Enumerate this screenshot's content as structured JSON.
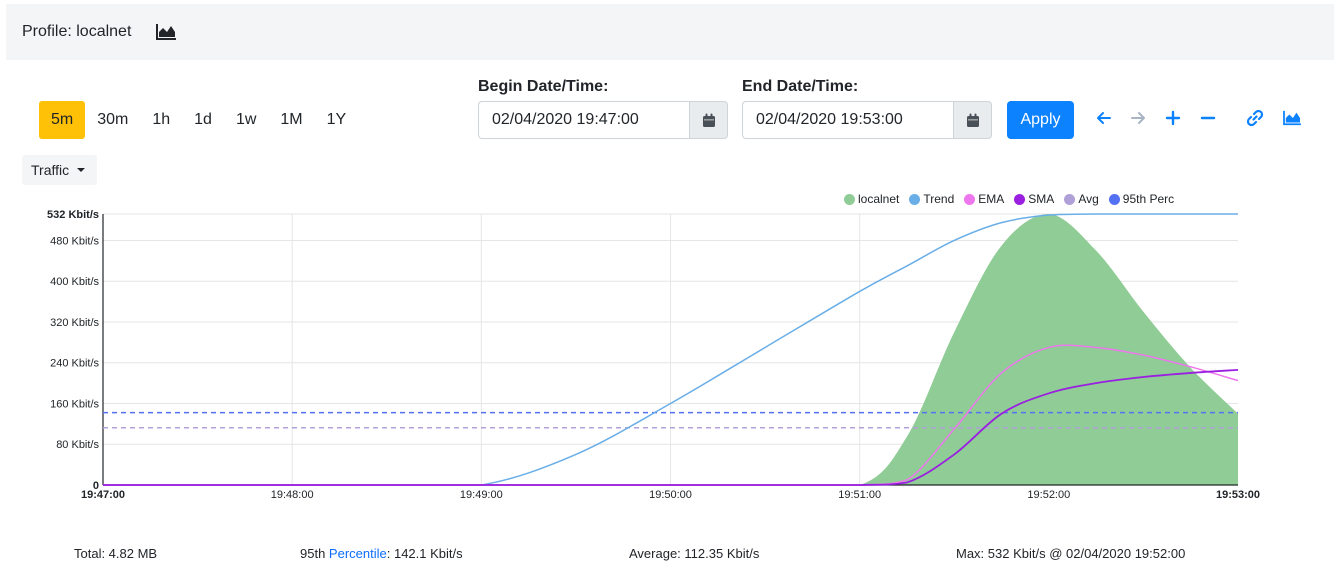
{
  "header": {
    "title": "Profile: localnet",
    "icon": "area-chart-icon"
  },
  "range_buttons": [
    {
      "label": "5m",
      "active": true
    },
    {
      "label": "30m",
      "active": false
    },
    {
      "label": "1h",
      "active": false
    },
    {
      "label": "1d",
      "active": false
    },
    {
      "label": "1w",
      "active": false
    },
    {
      "label": "1M",
      "active": false
    },
    {
      "label": "1Y",
      "active": false
    }
  ],
  "begin": {
    "label": "Begin Date/Time:",
    "value": "02/04/2020 19:47:00"
  },
  "end": {
    "label": "End Date/Time:",
    "value": "02/04/2020 19:53:00"
  },
  "apply_label": "Apply",
  "nav_icons": [
    "arrow-left-icon",
    "arrow-right-icon",
    "plus-icon",
    "minus-icon",
    "link-icon",
    "area-chart-icon"
  ],
  "dropdown": {
    "label": "Traffic"
  },
  "colors": {
    "accent": "#0d82ff",
    "active_range": "#ffc107",
    "localnet": "#8fcc96",
    "trend": "#6aaee8",
    "ema": "#ee77ee",
    "sma": "#9b1fe0",
    "avg": "#b0a0d8",
    "perc95": "#5470f5"
  },
  "chart_data": {
    "type": "area",
    "x": [
      "19:47:00",
      "19:47:30",
      "19:48:00",
      "19:48:30",
      "19:49:00",
      "19:49:30",
      "19:50:00",
      "19:50:30",
      "19:51:00",
      "19:51:15",
      "19:51:30",
      "19:51:45",
      "19:52:00",
      "19:52:15",
      "19:52:30",
      "19:52:45",
      "19:53:00"
    ],
    "x_ticks": [
      "19:47:00",
      "19:48:00",
      "19:49:00",
      "19:50:00",
      "19:51:00",
      "19:52:00",
      "19:53:00"
    ],
    "y_ticks": [
      "0",
      "80 Kbit/s",
      "160 Kbit/s",
      "240 Kbit/s",
      "320 Kbit/s",
      "400 Kbit/s",
      "480 Kbit/s",
      "532 Kbit/s"
    ],
    "ylim": [
      0,
      532
    ],
    "legend": [
      "localnet",
      "Trend",
      "EMA",
      "SMA",
      "Avg",
      "95th Perc"
    ],
    "legend_placement": "top-right",
    "series": [
      {
        "name": "localnet",
        "values": [
          0,
          0,
          0,
          0,
          0,
          0,
          0,
          0,
          0,
          95,
          300,
          470,
          532,
          460,
          340,
          230,
          140
        ]
      },
      {
        "name": "Trend",
        "values": [
          0,
          0,
          0,
          0,
          0,
          60,
          160,
          270,
          380,
          430,
          480,
          515,
          530,
          532,
          532,
          532,
          532
        ]
      },
      {
        "name": "EMA",
        "values": [
          0,
          0,
          0,
          0,
          0,
          0,
          0,
          0,
          0,
          10,
          110,
          220,
          270,
          270,
          255,
          232,
          205
        ]
      },
      {
        "name": "SMA",
        "values": [
          0,
          0,
          0,
          0,
          0,
          0,
          0,
          0,
          0,
          5,
          60,
          140,
          180,
          200,
          212,
          220,
          226
        ]
      },
      {
        "name": "Avg",
        "values": [
          112.35,
          112.35,
          112.35,
          112.35,
          112.35,
          112.35,
          112.35,
          112.35,
          112.35,
          112.35,
          112.35,
          112.35,
          112.35,
          112.35,
          112.35,
          112.35,
          112.35
        ]
      },
      {
        "name": "95th Perc",
        "values": [
          142.1,
          142.1,
          142.1,
          142.1,
          142.1,
          142.1,
          142.1,
          142.1,
          142.1,
          142.1,
          142.1,
          142.1,
          142.1,
          142.1,
          142.1,
          142.1,
          142.1
        ]
      }
    ],
    "grid": true
  },
  "footer": {
    "total": "Total: 4.82 MB",
    "perc_prefix": "95th ",
    "perc_link": "Percentile",
    "perc_value": ": 142.1 Kbit/s",
    "average": "Average: 112.35 Kbit/s",
    "max": "Max: 532 Kbit/s @ 02/04/2020 19:52:00"
  }
}
